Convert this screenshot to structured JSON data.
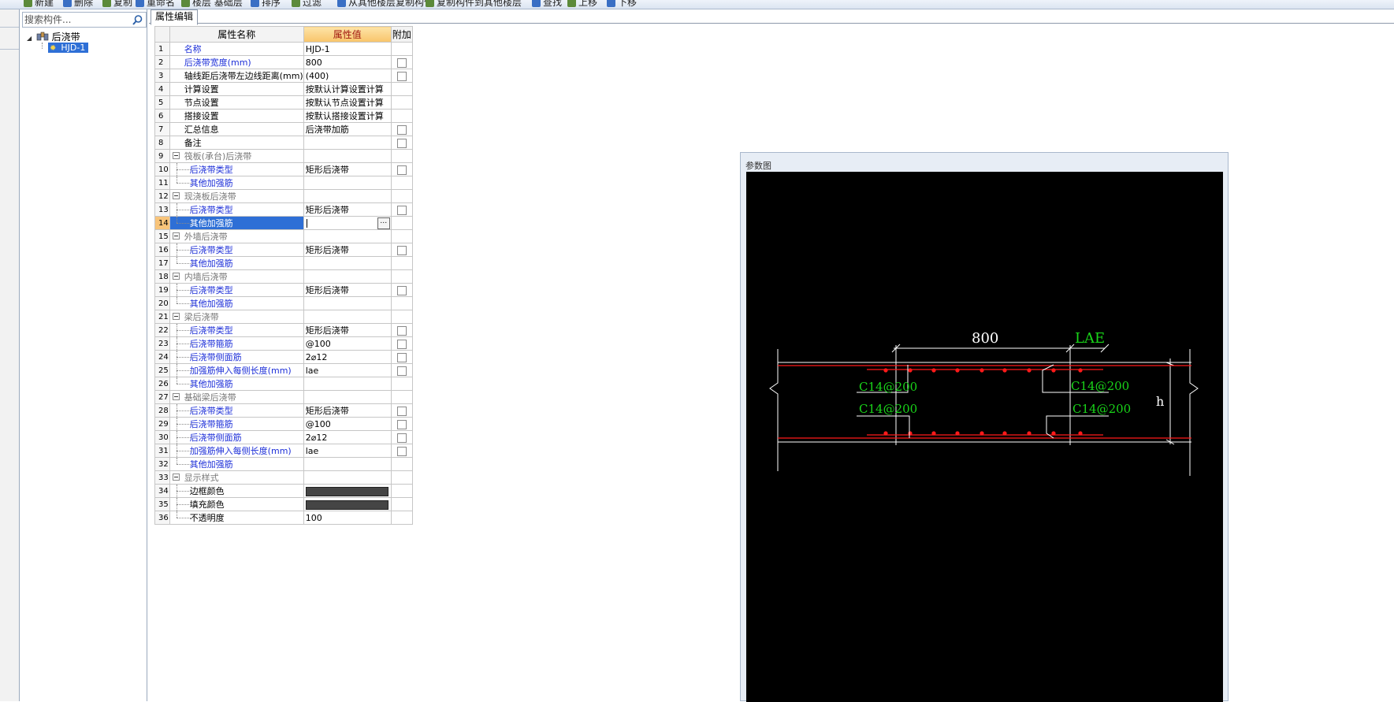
{
  "toolbar": {
    "items": [
      {
        "icon": "new-icon",
        "label": "新建"
      },
      {
        "icon": "delete-icon",
        "label": "删除"
      },
      {
        "icon": "copy-icon",
        "label": "复制"
      },
      {
        "icon": "rename-icon",
        "label": "重命名"
      },
      {
        "icon": "layer-icon",
        "label": "楼层 基础层"
      },
      {
        "icon": "sort-icon",
        "label": "排序"
      },
      {
        "icon": "filter-icon",
        "label": "过滤"
      },
      {
        "icon": "copy-from-floor-icon",
        "label": "从其他楼层复制构件"
      },
      {
        "icon": "copy-to-floor-icon",
        "label": "复制构件到其他楼层"
      },
      {
        "icon": "find-icon",
        "label": "查找"
      },
      {
        "icon": "up-icon",
        "label": "上移"
      },
      {
        "icon": "down-icon",
        "label": "下移"
      }
    ]
  },
  "sidebar": {
    "search_placeholder": "搜索构件...",
    "tree": {
      "root_label": "后浇带",
      "children": [
        {
          "label": "HJD-1",
          "selected": true
        }
      ]
    }
  },
  "tabs": [
    {
      "label": "属性编辑",
      "active": true
    }
  ],
  "grid": {
    "headers": {
      "name": "属性名称",
      "value": "属性值",
      "extra": "附加"
    },
    "selected_row": 14,
    "rows": [
      {
        "num": "1",
        "name": "名称",
        "value": "HJD-1",
        "color": "blue",
        "kind": "top",
        "cb": false
      },
      {
        "num": "2",
        "name": "后浇带宽度(mm)",
        "value": "800",
        "color": "blue",
        "kind": "top",
        "cb": true
      },
      {
        "num": "3",
        "name": "轴线距后浇带左边线距离(mm)",
        "value": "(400)",
        "color": "black",
        "kind": "top",
        "cb": true
      },
      {
        "num": "4",
        "name": "计算设置",
        "value": "按默认计算设置计算",
        "color": "black",
        "kind": "top",
        "cb": false
      },
      {
        "num": "5",
        "name": "节点设置",
        "value": "按默认节点设置计算",
        "color": "black",
        "kind": "top",
        "cb": false
      },
      {
        "num": "6",
        "name": "搭接设置",
        "value": "按默认搭接设置计算",
        "color": "black",
        "kind": "top",
        "cb": false
      },
      {
        "num": "7",
        "name": "汇总信息",
        "value": "后浇带加筋",
        "color": "black",
        "kind": "top",
        "cb": true
      },
      {
        "num": "8",
        "name": "备注",
        "value": "",
        "color": "black",
        "kind": "top",
        "cb": true
      },
      {
        "num": "9",
        "name": "筏板(承台)后浇带",
        "value": "",
        "color": "gray",
        "kind": "group",
        "cb": false
      },
      {
        "num": "10",
        "name": "后浇带类型",
        "value": "矩形后浇带",
        "color": "blue",
        "kind": "child",
        "cb": true
      },
      {
        "num": "11",
        "name": "其他加强筋",
        "value": "",
        "color": "blue",
        "kind": "child-last",
        "cb": false
      },
      {
        "num": "12",
        "name": "现浇板后浇带",
        "value": "",
        "color": "gray",
        "kind": "group",
        "cb": false
      },
      {
        "num": "13",
        "name": "后浇带类型",
        "value": "矩形后浇带",
        "color": "blue",
        "kind": "child",
        "cb": true
      },
      {
        "num": "14",
        "name": "其他加强筋",
        "value": "",
        "color": "blue",
        "kind": "child-last",
        "cb": false,
        "editing": true
      },
      {
        "num": "15",
        "name": "外墙后浇带",
        "value": "",
        "color": "gray",
        "kind": "group",
        "cb": false
      },
      {
        "num": "16",
        "name": "后浇带类型",
        "value": "矩形后浇带",
        "color": "blue",
        "kind": "child",
        "cb": true
      },
      {
        "num": "17",
        "name": "其他加强筋",
        "value": "",
        "color": "blue",
        "kind": "child-last",
        "cb": false
      },
      {
        "num": "18",
        "name": "内墙后浇带",
        "value": "",
        "color": "gray",
        "kind": "group",
        "cb": false
      },
      {
        "num": "19",
        "name": "后浇带类型",
        "value": "矩形后浇带",
        "color": "blue",
        "kind": "child",
        "cb": true
      },
      {
        "num": "20",
        "name": "其他加强筋",
        "value": "",
        "color": "blue",
        "kind": "child-last",
        "cb": false
      },
      {
        "num": "21",
        "name": "梁后浇带",
        "value": "",
        "color": "gray",
        "kind": "group",
        "cb": false
      },
      {
        "num": "22",
        "name": "后浇带类型",
        "value": "矩形后浇带",
        "color": "blue",
        "kind": "child",
        "cb": true
      },
      {
        "num": "23",
        "name": "后浇带箍筋",
        "value": "@100",
        "color": "blue",
        "kind": "child",
        "cb": true
      },
      {
        "num": "24",
        "name": "后浇带侧面筋",
        "value": "2⌀12",
        "color": "blue",
        "kind": "child",
        "cb": true
      },
      {
        "num": "25",
        "name": "加强筋伸入每侧长度(mm)",
        "value": "lae",
        "color": "blue",
        "kind": "child",
        "cb": true
      },
      {
        "num": "26",
        "name": "其他加强筋",
        "value": "",
        "color": "blue",
        "kind": "child-last",
        "cb": false
      },
      {
        "num": "27",
        "name": "基础梁后浇带",
        "value": "",
        "color": "gray",
        "kind": "group",
        "cb": false
      },
      {
        "num": "28",
        "name": "后浇带类型",
        "value": "矩形后浇带",
        "color": "blue",
        "kind": "child",
        "cb": true
      },
      {
        "num": "29",
        "name": "后浇带箍筋",
        "value": "@100",
        "color": "blue",
        "kind": "child",
        "cb": true
      },
      {
        "num": "30",
        "name": "后浇带侧面筋",
        "value": "2⌀12",
        "color": "blue",
        "kind": "child",
        "cb": true
      },
      {
        "num": "31",
        "name": "加强筋伸入每侧长度(mm)",
        "value": "lae",
        "color": "blue",
        "kind": "child",
        "cb": true
      },
      {
        "num": "32",
        "name": "其他加强筋",
        "value": "",
        "color": "blue",
        "kind": "child-last",
        "cb": false
      },
      {
        "num": "33",
        "name": "显示样式",
        "value": "",
        "color": "gray",
        "kind": "group",
        "cb": false
      },
      {
        "num": "34",
        "name": "边框颜色",
        "value": "",
        "color": "black",
        "kind": "child",
        "cb": false,
        "swatch": "#454545"
      },
      {
        "num": "35",
        "name": "填充颜色",
        "value": "",
        "color": "black",
        "kind": "child",
        "cb": false,
        "swatch": "#454545"
      },
      {
        "num": "36",
        "name": "不透明度",
        "value": "100",
        "color": "black",
        "kind": "child-last",
        "cb": false
      }
    ]
  },
  "diagram": {
    "title": "参数图",
    "width_label": "800",
    "lae_label": "LAE",
    "h_label": "h",
    "rebar_labels": [
      "C14@200",
      "C14@200",
      "C14@200",
      "C14@200"
    ],
    "colors": {
      "background": "#000000",
      "rebar": "#ff1a1a",
      "label": "#19d419",
      "line": "#ffffff"
    }
  },
  "colors": {
    "selected_row": "#2e6fd6",
    "header_highlight": "#f8c46a",
    "blue_text": "#1d2fd8"
  }
}
